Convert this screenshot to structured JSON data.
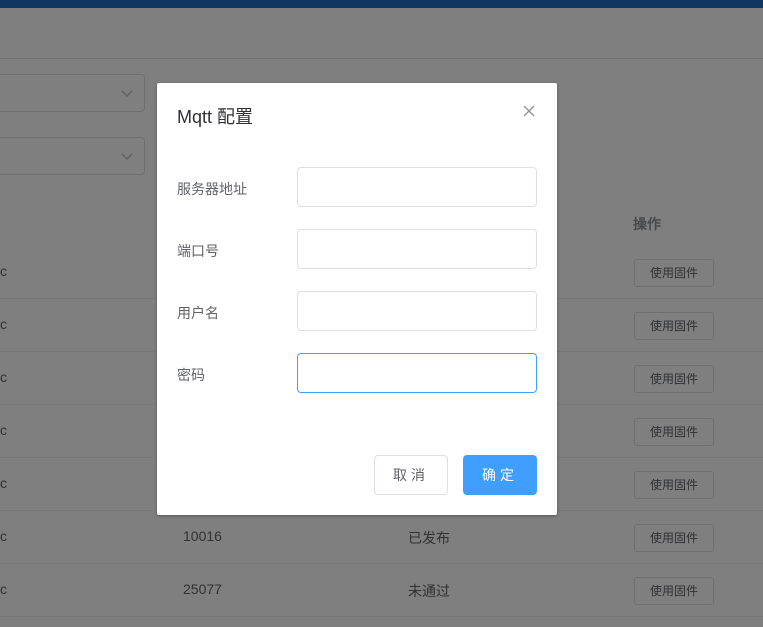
{
  "background": {
    "table": {
      "column_header_op": "操作",
      "rows": [
        {
          "c1": "c",
          "c2": "",
          "c3": "",
          "action": "使用固件"
        },
        {
          "c1": "c",
          "c2": "",
          "c3": "",
          "action": "使用固件"
        },
        {
          "c1": "c",
          "c2": "",
          "c3": "",
          "action": "使用固件"
        },
        {
          "c1": "c",
          "c2": "",
          "c3": "",
          "action": "使用固件"
        },
        {
          "c1": "c",
          "c2": "",
          "c3": "",
          "action": "使用固件"
        },
        {
          "c1": "c",
          "c2": "10016",
          "c3": "已发布",
          "action": "使用固件"
        },
        {
          "c1": "c",
          "c2": "25077",
          "c3": "未通过",
          "action": "使用固件"
        }
      ]
    }
  },
  "dialog": {
    "title": "Mqtt 配置",
    "fields": [
      {
        "label": "服务器地址",
        "value": ""
      },
      {
        "label": "端口号",
        "value": ""
      },
      {
        "label": "用户名",
        "value": ""
      },
      {
        "label": "密码",
        "value": ""
      }
    ],
    "cancel_label": "取消",
    "ok_label": "确定"
  },
  "colors": {
    "primary": "#409eff",
    "topbar": "#1f6fbf"
  }
}
